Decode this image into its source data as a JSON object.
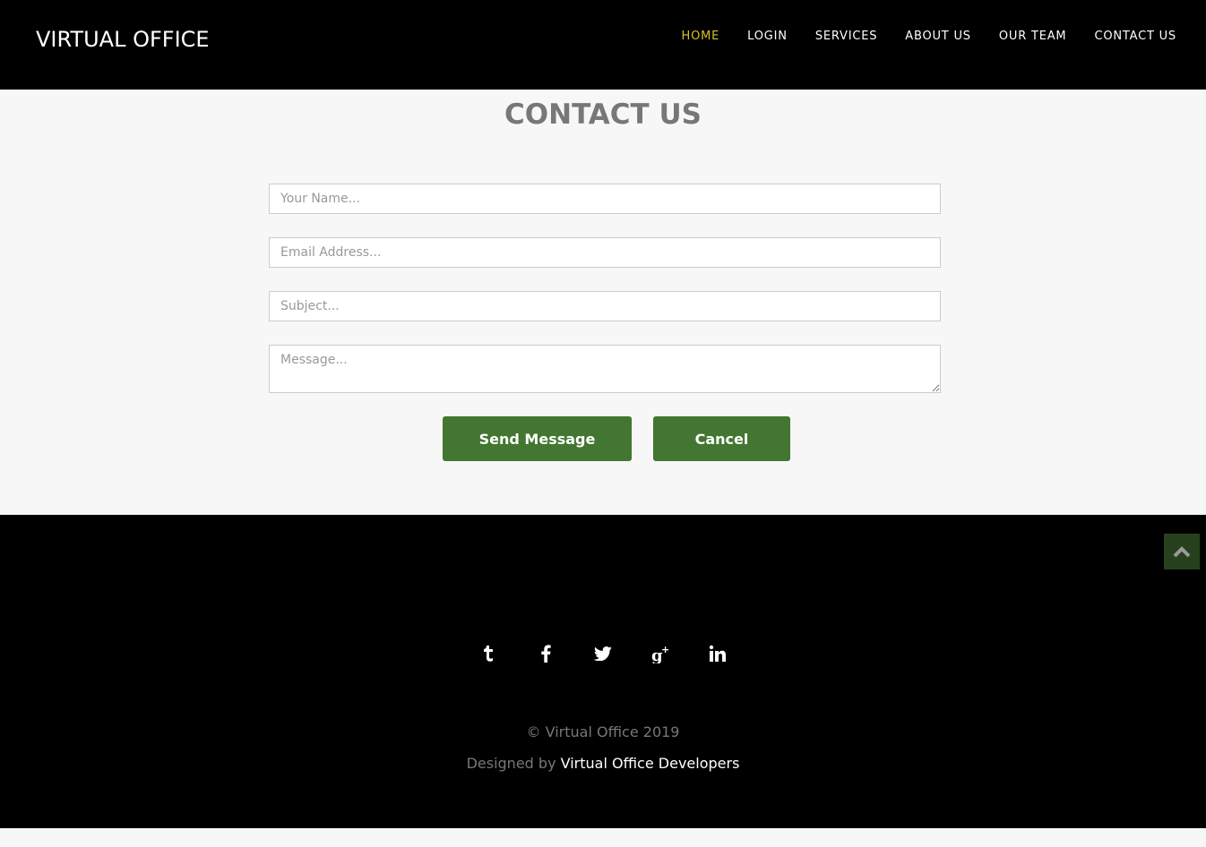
{
  "header": {
    "brand": "VIRTUAL OFFICE",
    "nav": [
      "HOME",
      "LOGIN",
      "SERVICES",
      "ABOUT US",
      "OUR TEAM",
      "CONTACT US"
    ],
    "active_color": "#d8c31c"
  },
  "contact": {
    "title": "CONTACT US",
    "name_placeholder": "Your Name...",
    "email_placeholder": "Email Address...",
    "subject_placeholder": "Subject...",
    "message_placeholder": "Message...",
    "send_label": "Send Message",
    "cancel_label": "Cancel",
    "button_color": "#437631"
  },
  "footer": {
    "social_icons": [
      "tumblr-icon",
      "facebook-icon",
      "twitter-icon",
      "google-plus-icon",
      "linkedin-icon"
    ],
    "copyright": "© Virtual Office 2019",
    "designed_prefix": "Designed by",
    "designed_by": "Virtual Office Developers"
  }
}
